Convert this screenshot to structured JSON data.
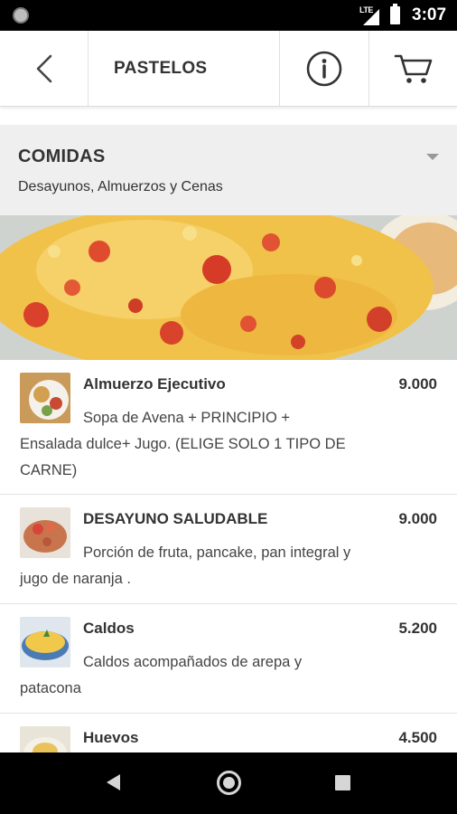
{
  "status_bar": {
    "network_label": "LTE",
    "time": "3:07"
  },
  "toolbar": {
    "title": "PASTELOS",
    "icons": [
      "back-arrow-icon",
      "info-icon",
      "cart-icon"
    ]
  },
  "category": {
    "title": "COMIDAS",
    "subtitle": "Desayunos, Almuerzos y Cenas"
  },
  "menu": {
    "items": [
      {
        "name": "Almuerzo Ejecutivo",
        "price": "9.000",
        "description": "Sopa de Avena + PRINCIPIO + Ensalada dulce+ Jugo. (ELIGE SOLO 1 TIPO DE CARNE)"
      },
      {
        "name": "DESAYUNO SALUDABLE",
        "price": "9.000",
        "description": "Porción de fruta, pancake, pan integral y jugo de naranja ."
      },
      {
        "name": "Caldos",
        "price": "5.200",
        "description": "Caldos acompañados de arepa y patacona"
      },
      {
        "name": "Huevos",
        "price": "4.500",
        "description": ""
      }
    ]
  },
  "colors": {
    "accent": "#333333",
    "category_bg": "#efefef",
    "divider": "#e3e3e3"
  }
}
